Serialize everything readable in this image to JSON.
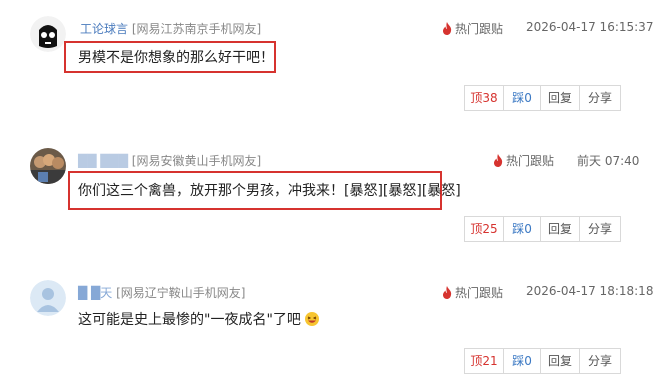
{
  "comments": [
    {
      "user": "工论球言",
      "source": "[网易江苏南京手机网友]",
      "hot_label": "热门跟贴",
      "time": "2026-04-17 16:15:37",
      "text": "男模不是你想象的那么好干吧！",
      "up_label": "顶",
      "up_count": "38",
      "down_label": "踩",
      "down_count": "0",
      "reply_label": "回复",
      "share_label": "分享"
    },
    {
      "user": "██ ███",
      "source": "[网易安徽黄山手机网友]",
      "hot_label": "热门跟贴",
      "time": "前天 07:40",
      "text": "你们这三个禽兽，放开那个男孩，冲我来！[暴怒][暴怒][暴怒]",
      "up_label": "顶",
      "up_count": "25",
      "down_label": "踩",
      "down_count": "0",
      "reply_label": "回复",
      "share_label": "分享"
    },
    {
      "user": "█ █天",
      "source": "[网易辽宁鞍山手机网友]",
      "hot_label": "热门跟贴",
      "time": "2026-04-17 18:18:18",
      "text": "这可能是史上最惨的\"一夜成名\"了吧",
      "up_label": "顶",
      "up_count": "21",
      "down_label": "踩",
      "down_count": "0",
      "reply_label": "回复",
      "share_label": "分享"
    }
  ],
  "colors": {
    "accent_red": "#d6332f",
    "user_blue": "#4a7bbd",
    "down_blue": "#3a78c3"
  }
}
